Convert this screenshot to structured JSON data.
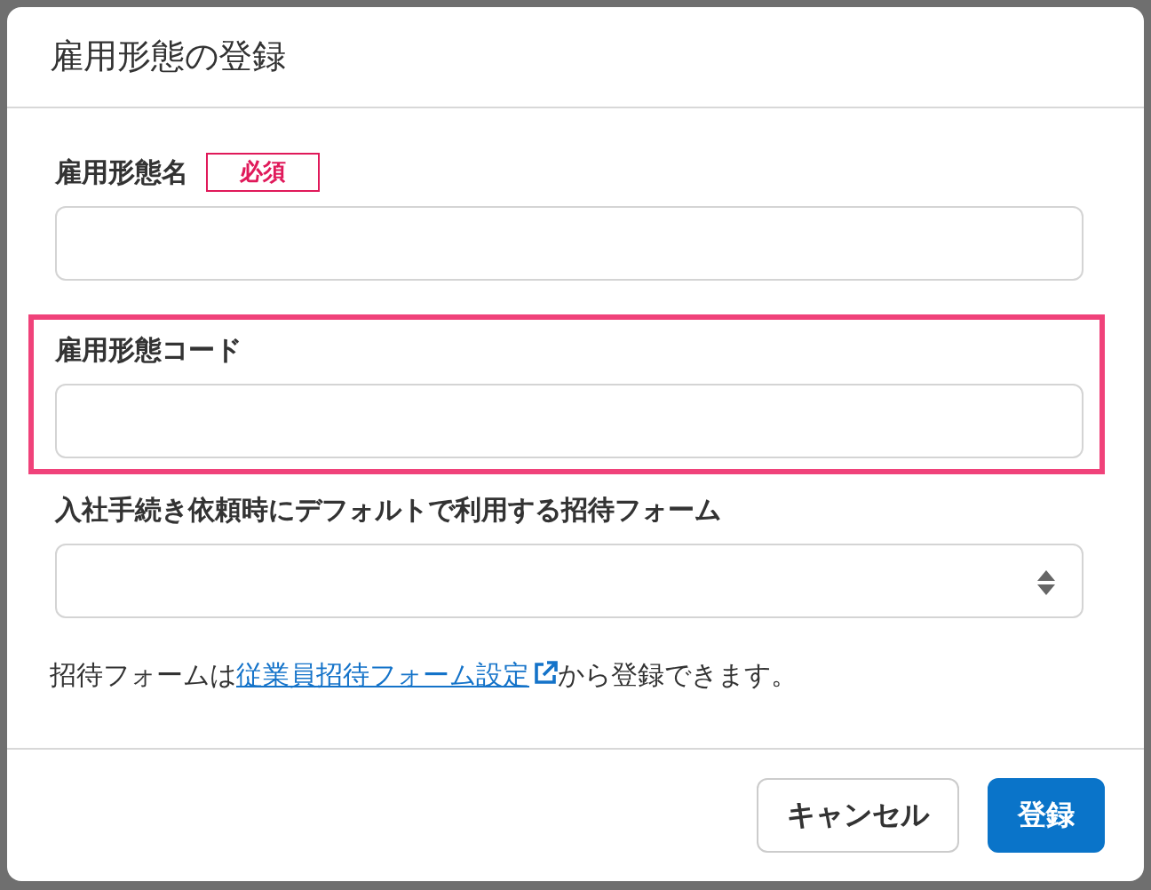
{
  "dialog": {
    "title": "雇用形態の登録",
    "fields": [
      {
        "kind": "text",
        "label": "雇用形態名",
        "badge": "必須",
        "highlighted": false
      },
      {
        "kind": "text",
        "label": "雇用形態コード",
        "highlighted": true
      },
      {
        "kind": "select",
        "label": "入社手続き依頼時にデフォルトで利用する招待フォーム",
        "highlighted": false
      }
    ],
    "note": {
      "before": "招待フォームは",
      "link": "従業員招待フォーム設定",
      "after": "から登録できます。"
    },
    "buttons": [
      {
        "kind": "secondary",
        "label": "キャンセル"
      },
      {
        "kind": "primary",
        "label": "登録"
      }
    ]
  }
}
